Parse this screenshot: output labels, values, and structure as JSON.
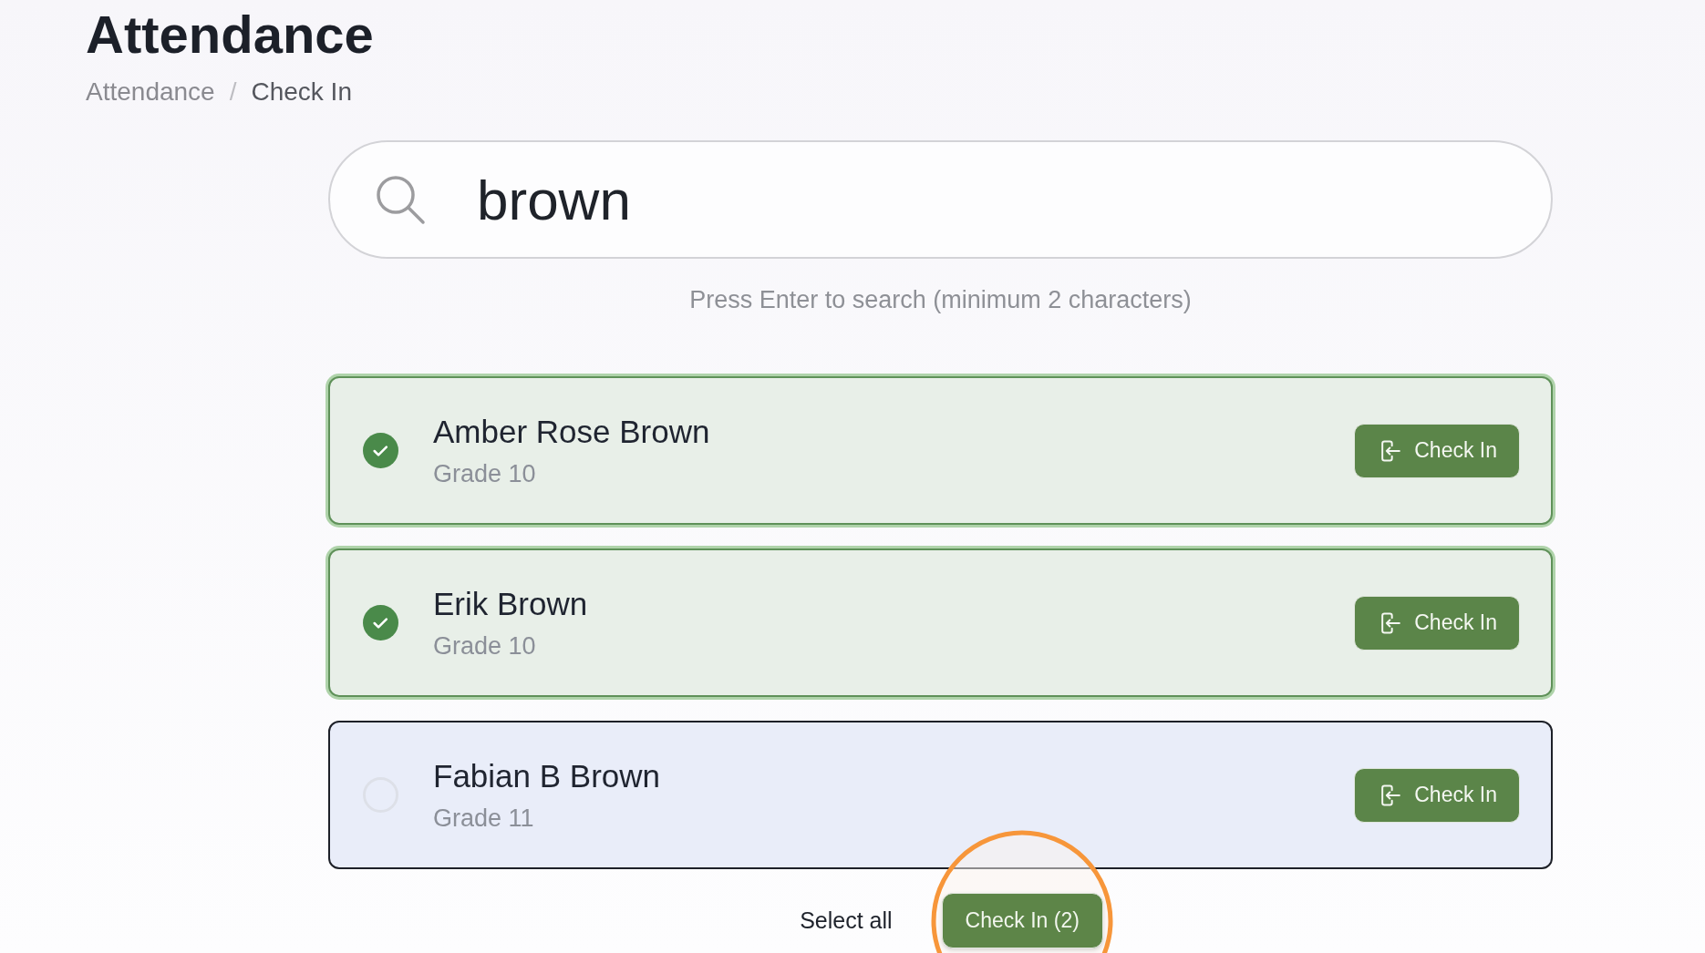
{
  "page": {
    "title": "Attendance"
  },
  "breadcrumb": {
    "separator": "/",
    "items": [
      {
        "label": "Attendance",
        "current": false
      },
      {
        "label": "Check In",
        "current": true
      }
    ]
  },
  "search": {
    "value": "brown",
    "hint": "Press Enter to search (minimum 2 characters)"
  },
  "students": [
    {
      "name": "Amber Rose Brown",
      "grade": "Grade 10",
      "selected": true,
      "focused": false,
      "action": "Check In"
    },
    {
      "name": "Erik Brown",
      "grade": "Grade 10",
      "selected": true,
      "focused": false,
      "action": "Check In"
    },
    {
      "name": "Fabian B Brown",
      "grade": "Grade 11",
      "selected": false,
      "focused": true,
      "action": "Check In"
    }
  ],
  "footer": {
    "select_all": "Select all",
    "submit": "Check In (2)"
  }
}
